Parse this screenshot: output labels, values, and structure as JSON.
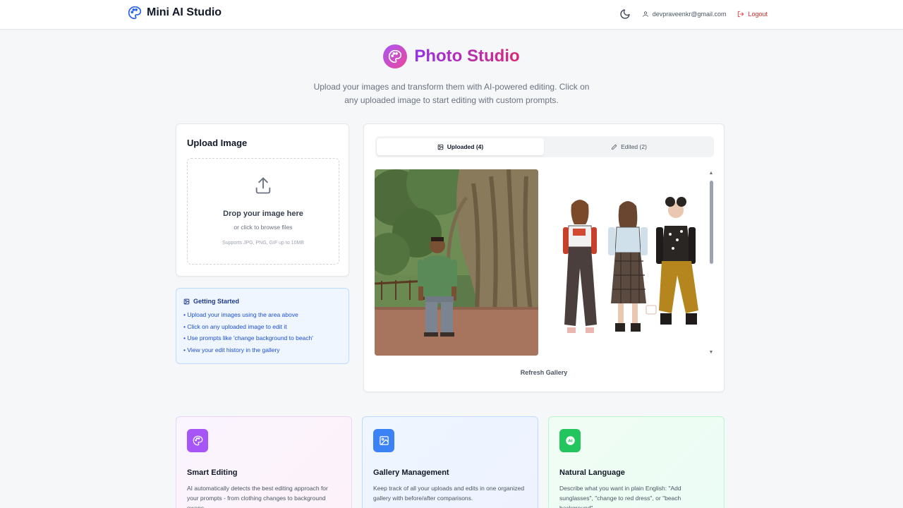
{
  "header": {
    "app_title": "Mini AI Studio",
    "user_email": "devpraveenkr@gmail.com",
    "logout_label": "Logout",
    "theme_icon": "moon-icon"
  },
  "hero": {
    "title": "Photo Studio",
    "subtitle": "Upload your images and transform them with AI-powered editing. Click on any uploaded image to start editing with custom prompts."
  },
  "upload": {
    "title": "Upload Image",
    "drop_main": "Drop your image here",
    "drop_sub": "or click to browse files",
    "drop_hint": "Supports JPG, PNG, GIF up to 10MB"
  },
  "getting_started": {
    "title": "Getting Started",
    "items": [
      "• Upload your images using the area above",
      "• Click on any uploaded image to edit it",
      "• Use prompts like 'change background to beach'",
      "• View your edit history in the gallery"
    ]
  },
  "gallery": {
    "tab_uploaded": "Uploaded (4)",
    "tab_edited": "Edited (2)",
    "active_tab": "uploaded",
    "refresh_label": "Refresh Gallery"
  },
  "features": [
    {
      "title": "Smart Editing",
      "desc": "AI automatically detects the best editing approach for your prompts - from clothing changes to background swaps.",
      "icon": "palette-icon",
      "color": "#a855f7"
    },
    {
      "title": "Gallery Management",
      "desc": "Keep track of all your uploads and edits in one organized gallery with before/after comparisons.",
      "icon": "image-icon",
      "color": "#3b82f6"
    },
    {
      "title": "Natural Language",
      "desc": "Describe what you want in plain English: \"Add sunglasses\", \"change to red dress\", or \"beach background\".",
      "icon": "ai-icon",
      "color": "#22c55e"
    }
  ]
}
